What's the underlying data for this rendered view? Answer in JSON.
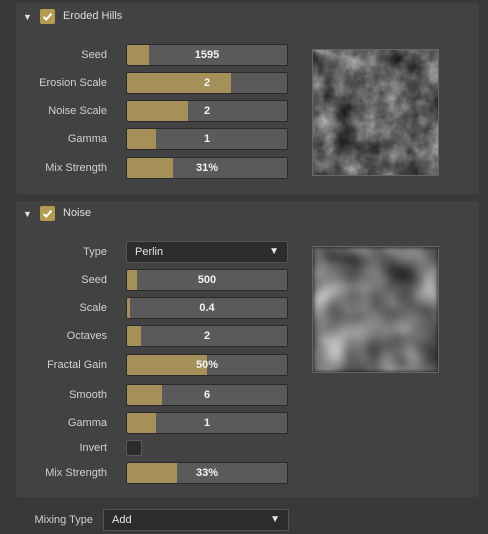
{
  "panels": [
    {
      "title": "Eroded Hills",
      "enabled": true,
      "rows": [
        {
          "label": "Seed",
          "value": "1595",
          "fill": 0.14
        },
        {
          "label": "Erosion Scale",
          "value": "2",
          "fill": 0.65
        },
        {
          "label": "Noise Scale",
          "value": "2",
          "fill": 0.38
        },
        {
          "label": "Gamma",
          "value": "1",
          "fill": 0.18
        },
        {
          "label": "Mix Strength",
          "value": "31%",
          "fill": 0.29
        }
      ]
    },
    {
      "title": "Noise",
      "enabled": true,
      "type_label": "Type",
      "type_value": "Perlin",
      "rows": [
        {
          "label": "Seed",
          "value": "500",
          "fill": 0.06
        },
        {
          "label": "Scale",
          "value": "0.4",
          "fill": 0.02
        },
        {
          "label": "Octaves",
          "value": "2",
          "fill": 0.09
        },
        {
          "label": "Fractal Gain",
          "value": "50%",
          "fill": 0.5
        },
        {
          "label": "Smooth",
          "value": "6",
          "fill": 0.22
        },
        {
          "label": "Gamma",
          "value": "1",
          "fill": 0.18
        }
      ],
      "invert_label": "Invert",
      "invert": false,
      "mix_label": "Mix Strength",
      "mix_value": "33%",
      "mix_fill": 0.31
    }
  ],
  "mixing": {
    "label": "Mixing Type",
    "value": "Add"
  },
  "colors": {
    "accent": "#b39b52",
    "fill": "#a5905a",
    "panel": "#424242",
    "background": "#393939"
  },
  "icons": {
    "collapse": "chevron-down-icon",
    "check": "checkmark-icon",
    "dropdown": "dropdown-arrow-icon"
  }
}
